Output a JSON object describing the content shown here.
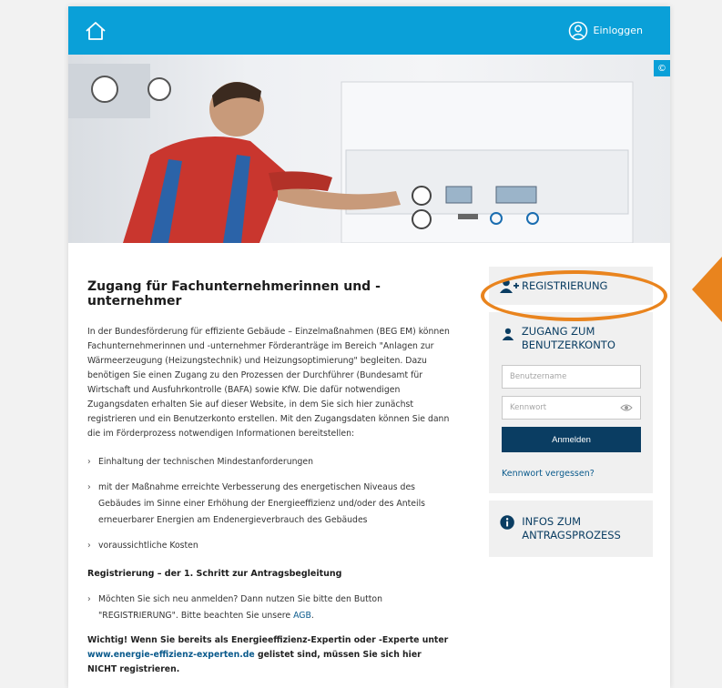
{
  "header": {
    "home_icon": "home-icon",
    "login_label": "Einloggen",
    "login_icon": "user-circle-icon",
    "copyright_symbol": "©"
  },
  "main": {
    "title": "Zugang für Fachunternehmerinnen und -unternehmer",
    "intro": "In der Bundesförderung für effiziente Gebäude – Einzelmaßnahmen (BEG EM) können Fachunternehmerinnen und -unternehmer Förderanträge im Bereich \"Anlagen zur Wärmeerzeugung (Heizungstechnik) und Heizungsoptimierung\" begleiten. Dazu benötigen Sie einen Zugang zu den Prozessen der Durchführer (Bundesamt für Wirtschaft und Ausfuhrkontrolle (BAFA) sowie KfW. Die dafür notwendigen Zugangsdaten erhalten Sie auf dieser Website, in dem Sie sich hier zunächst registrieren und ein Benutzerkonto erstellen. Mit den Zugangsdaten können Sie dann die im Förderprozess notwendigen Informationen bereitstellen:",
    "requirements": [
      "Einhaltung der technischen Mindestanforderungen",
      "mit der Maßnahme erreichte Verbesserung des energetischen Niveaus des Gebäudes im Sinne einer Erhöhung der Energieeffizienz und/oder des Anteils erneuerbarer Energien am Endenergieverbrauch des Gebäudes",
      "voraussichtliche Kosten"
    ],
    "registration_heading": "Registrierung – der 1. Schritt zur Antragsbegleitung",
    "registration_note_pre": "Möchten Sie sich neu anmelden? Dann nutzen Sie bitte den Button \"REGISTRIERUNG\". Bitte beachten Sie unsere ",
    "registration_note_link": "AGB",
    "registration_note_post": ".",
    "warning_pre": "Wichtig! Wenn Sie bereits als Energieeffizienz-Expertin oder -Experte unter ",
    "warning_link": "www.energie-effizienz-experten.de",
    "warning_post": " gelistet sind, müssen Sie sich hier NICHT registrieren."
  },
  "sidebar": {
    "register_label": "REGISTRIERUNG",
    "register_icon": "user-plus-icon",
    "account_title": "ZUGANG ZUM BENUTZERKONTO",
    "account_icon": "user-icon",
    "username_placeholder": "Benutzername",
    "password_placeholder": "Kennwort",
    "password_toggle_icon": "eye-icon",
    "submit_label": "Anmelden",
    "forgot_label": "Kennwort vergessen?",
    "info_title": "INFOS ZUM ANTRAGSPROZESS",
    "info_icon": "info-icon"
  },
  "colors": {
    "header_blue": "#0aa0d8",
    "navy": "#0a3d62",
    "link": "#0a5a8c",
    "highlight_orange": "#e9841e",
    "panel_gray": "#f0f0f0"
  }
}
